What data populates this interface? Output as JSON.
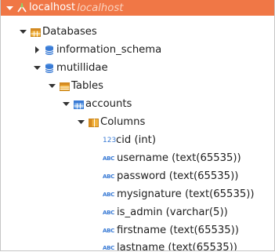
{
  "server": {
    "label": "localhost",
    "sublabel": "localhost"
  },
  "databases": {
    "label": "Databases"
  },
  "db_info": {
    "label": "information_schema"
  },
  "db_mutillidae": {
    "label": "mutillidae"
  },
  "tables": {
    "label": "Tables"
  },
  "table_accounts": {
    "label": "accounts"
  },
  "columns": {
    "label": "Columns"
  },
  "column_items": [
    {
      "label": "cid (int)",
      "type_icon": "123"
    },
    {
      "label": "username (text(65535))",
      "type_icon": "ABC"
    },
    {
      "label": "password (text(65535))",
      "type_icon": "ABC"
    },
    {
      "label": "mysignature (text(65535))",
      "type_icon": "ABC"
    },
    {
      "label": "is_admin (varchar(5))",
      "type_icon": "ABC"
    },
    {
      "label": "firstname (text(65535))",
      "type_icon": "ABC"
    },
    {
      "label": "lastname (text(65535))",
      "type_icon": "ABC"
    }
  ],
  "colors": {
    "selected_bg": "#f07746",
    "folder": "#e8a33a",
    "database": "#3a7bd5",
    "table": "#3a7bd5"
  }
}
